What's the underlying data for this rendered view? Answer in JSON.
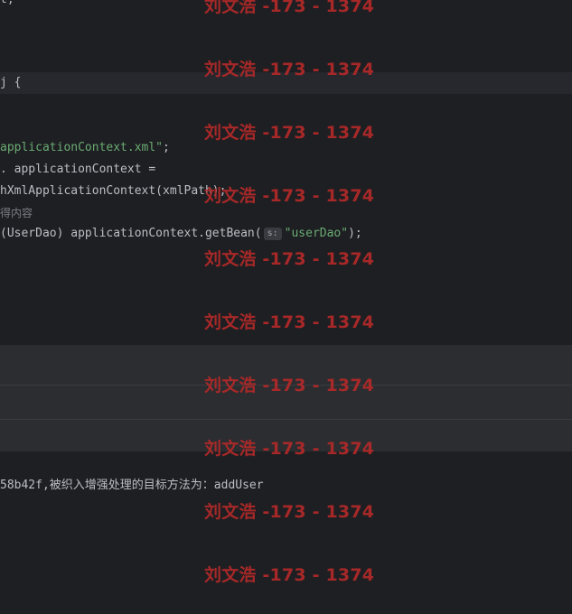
{
  "editor": {
    "lines": [
      {
        "text": "t;"
      },
      {
        "text": "j {"
      },
      {
        "string": "applicationContext.xml\"",
        "rest": ";"
      },
      {
        "text": ". applicationContext ="
      },
      {
        "text": "hXmlApplicationContext(xmlPath);"
      },
      {
        "text": "得内容"
      },
      {
        "before": "(UserDao) applicationContext.getBean(",
        "hint": "s:",
        "string": "\"userDao\"",
        "after": ");"
      }
    ]
  },
  "console": {
    "output": "58b42f,被织入增强处理的目标方法为：addUser"
  },
  "watermark": {
    "text": "刘文浩 -173 - 1374"
  }
}
